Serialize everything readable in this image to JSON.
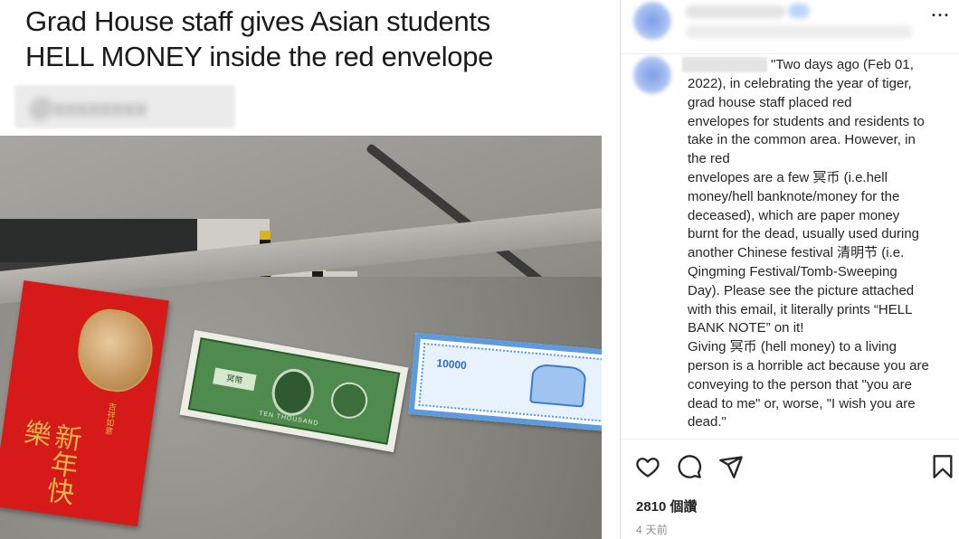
{
  "post": {
    "headline_line1": "Grad House staff gives Asian students",
    "headline_line2": "HELL MONEY inside the red envelope",
    "envelope_text": "新年快樂",
    "banknote_green_label": "冥幣",
    "banknote_green_footer": "TEN THOUSAND",
    "banknote_blue_number": "10000"
  },
  "comment": {
    "first_line": "\"Two days ago (Feb 01,",
    "body": "2022), in celebrating the year of tiger,\ngrad house staff placed red\nenvelopes for students and residents to\ntake in the common area. However, in\nthe red\nenvelopes are a few 冥币 (i.e.hell\nmoney/hell banknote/money for the\ndeceased), which are paper money\nburnt for the dead, usually used during\nanother Chinese festival 清明节 (i.e.\nQingming Festival/Tomb-Sweeping\nDay). Please see the picture attached\nwith this email, it literally prints “HELL\nBANK NOTE” on it!\nGiving 冥币 (hell money) to a living\nperson is a horrible act because you are\nconveying to the person that \"you are\ndead to me\" or, worse, \"I wish you are\ndead.\""
  },
  "header": {
    "more_label": "···"
  },
  "footer": {
    "likes": "2810 個讚",
    "timestamp": "4 天前"
  },
  "icons": {
    "like": "heart-icon",
    "comment": "comment-bubble-icon",
    "share": "paper-plane-icon",
    "save": "bookmark-icon"
  }
}
